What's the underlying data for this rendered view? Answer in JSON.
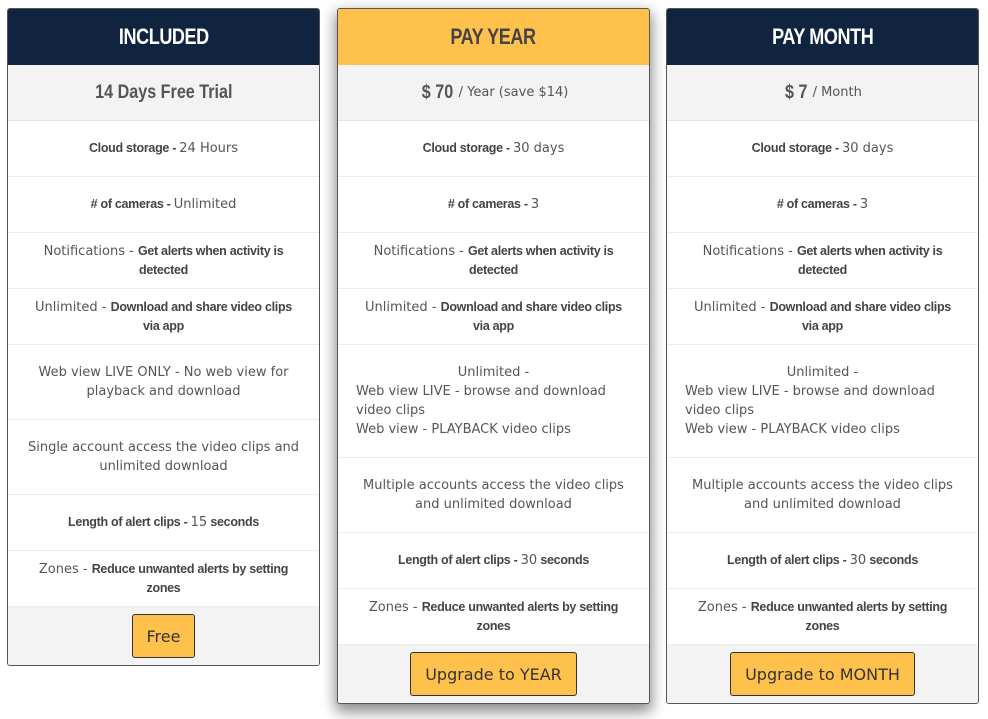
{
  "colors": {
    "navy": "#10233f",
    "gold": "#fec14c",
    "row_alt": "#f3f3f3"
  },
  "plans": [
    {
      "title": "INCLUDED",
      "price_main": "14 Days Free Trial",
      "features": {
        "cloud_storage": {
          "label": "Cloud storage - ",
          "value": "24 Hours"
        },
        "cameras": {
          "label": "# of cameras - ",
          "value": "Unlimited"
        },
        "notifications": {
          "label": "Notifications - ",
          "value": "Get alerts when activity is detected"
        },
        "clips": {
          "label": "Unlimited - ",
          "value": "Download and share video clips via app"
        },
        "web_view": {
          "text": "Web view LIVE ONLY - No web view for playback and download"
        },
        "accounts": {
          "text": "Single account access the video clips and unlimited download"
        },
        "clip_length": {
          "label": "Length of alert clips - ",
          "number": "15",
          "unit": " seconds"
        },
        "zones": {
          "label": "Zones - ",
          "value": "Reduce unwanted alerts by setting zones"
        }
      },
      "button": "Free"
    },
    {
      "title": "PAY YEAR",
      "price_main": "$ 70",
      "price_sub": "/ Year (save $14)",
      "features": {
        "cloud_storage": {
          "label": "Cloud storage - ",
          "value": "30 days"
        },
        "cameras": {
          "label": "# of cameras - ",
          "value": "3"
        },
        "notifications": {
          "label": "Notifications - ",
          "value": "Get alerts when activity is detected"
        },
        "clips": {
          "label": "Unlimited - ",
          "value": "Download and share video clips via app"
        },
        "web_view": {
          "line1": "Unlimited -",
          "line2": "Web view LIVE - browse and download video clips",
          "line3": "Web view - PLAYBACK video clips"
        },
        "accounts": {
          "text": "Multiple accounts access the video clips and unlimited download"
        },
        "clip_length": {
          "label": "Length of alert clips - ",
          "number": "30",
          "unit": " seconds"
        },
        "zones": {
          "label": "Zones - ",
          "value": "Reduce unwanted alerts by setting zones"
        }
      },
      "button": "Upgrade to YEAR"
    },
    {
      "title": "PAY MONTH",
      "price_main": "$ 7",
      "price_sub": "/ Month",
      "features": {
        "cloud_storage": {
          "label": "Cloud storage - ",
          "value": "30 days"
        },
        "cameras": {
          "label": "# of cameras - ",
          "value": "3"
        },
        "notifications": {
          "label": "Notifications - ",
          "value": "Get alerts when activity is detected"
        },
        "clips": {
          "label": "Unlimited - ",
          "value": "Download and share video clips via app"
        },
        "web_view": {
          "line1": "Unlimited -",
          "line2": "Web view LIVE - browse and download video clips",
          "line3": "Web view - PLAYBACK video clips"
        },
        "accounts": {
          "text": "Multiple accounts access the video clips and unlimited download"
        },
        "clip_length": {
          "label": "Length of alert clips - ",
          "number": "30",
          "unit": " seconds"
        },
        "zones": {
          "label": "Zones - ",
          "value": "Reduce unwanted alerts by setting zones"
        }
      },
      "button": "Upgrade to MONTH"
    }
  ]
}
